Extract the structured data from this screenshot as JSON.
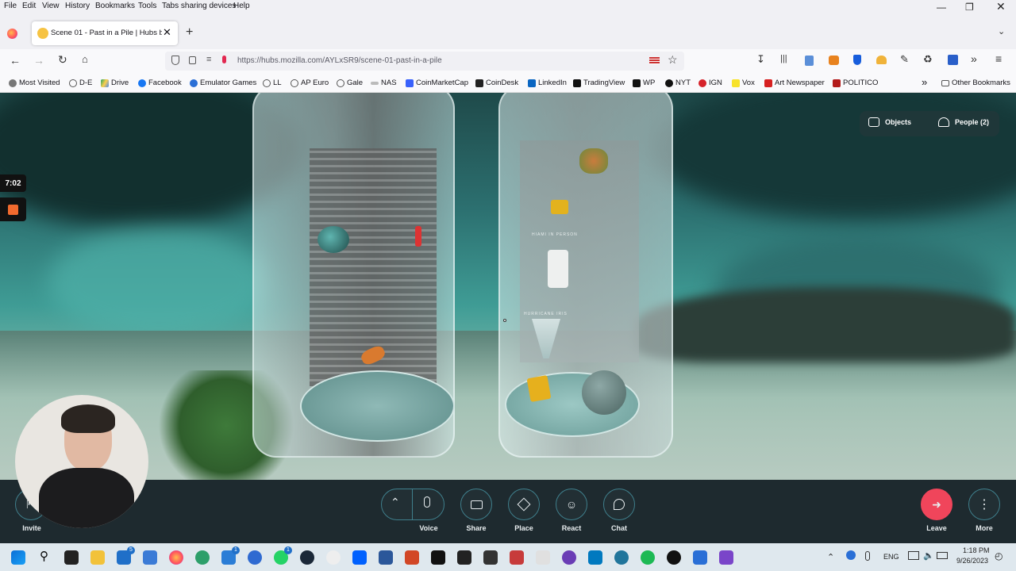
{
  "menubar": {
    "items": [
      "File",
      "Edit",
      "View",
      "History",
      "Bookmarks",
      "Tools",
      "Tabs sharing devices",
      "Help"
    ]
  },
  "tab": {
    "title": "Scene 01 - Past in a Pile | Hubs by I"
  },
  "address": {
    "url": "https://hubs.mozilla.com/AYLxSR9/scene-01-past-in-a-pile"
  },
  "bookmarks": [
    {
      "label": "Most Visited",
      "icon": "gear-icon",
      "color": "#555555"
    },
    {
      "label": "D-E",
      "icon": "globe-icon",
      "color": "#555555"
    },
    {
      "label": "Drive",
      "icon": "drive-icon",
      "color": "#1fa463"
    },
    {
      "label": "Facebook",
      "icon": "facebook-icon",
      "color": "#1877f2"
    },
    {
      "label": "Emulator Games",
      "icon": "g-icon",
      "color": "#2a6fd6"
    },
    {
      "label": "LL",
      "icon": "globe-icon",
      "color": "#555555"
    },
    {
      "label": "AP Euro",
      "icon": "globe-icon",
      "color": "#555555"
    },
    {
      "label": "Gale",
      "icon": "globe-icon",
      "color": "#555555"
    },
    {
      "label": "NAS",
      "icon": "synology-icon",
      "color": "#888888"
    },
    {
      "label": "CoinMarketCap",
      "icon": "cmc-icon",
      "color": "#3861fb"
    },
    {
      "label": "CoinDesk",
      "icon": "coindesk-icon",
      "color": "#222222"
    },
    {
      "label": "LinkedIn",
      "icon": "linkedin-icon",
      "color": "#0a66c2"
    },
    {
      "label": "TradingView",
      "icon": "tradingview-icon",
      "color": "#111111"
    },
    {
      "label": "WP",
      "icon": "wp-icon",
      "color": "#111111"
    },
    {
      "label": "NYT",
      "icon": "nyt-icon",
      "color": "#111111"
    },
    {
      "label": "IGN",
      "icon": "ign-icon",
      "color": "#d6222a"
    },
    {
      "label": "Vox",
      "icon": "vox-icon",
      "color": "#f7e22b"
    },
    {
      "label": "Art Newspaper",
      "icon": "artnews-icon",
      "color": "#d62020"
    },
    {
      "label": "POLITICO",
      "icon": "politico-icon",
      "color": "#b31b1b"
    }
  ],
  "bookmarks_other": "Other Bookmarks",
  "hubs": {
    "objects_label": "Objects",
    "people_label": "People (2)",
    "timer": "7:02",
    "wall_text_1": "HIAMI IN PERSON",
    "wall_text_2": "HURRICANE IRIS",
    "toolbar": {
      "invite": "Invite",
      "voice": "Voice",
      "share": "Share",
      "place": "Place",
      "react": "React",
      "chat": "Chat",
      "leave": "Leave",
      "more": "More"
    },
    "accent": "#f0455b"
  },
  "taskbar": {
    "lang": "ENG",
    "time": "1:18 PM",
    "date": "9/26/2023",
    "badges": {
      "mail": "5",
      "vscode": "1",
      "whatsapp": "1"
    }
  }
}
